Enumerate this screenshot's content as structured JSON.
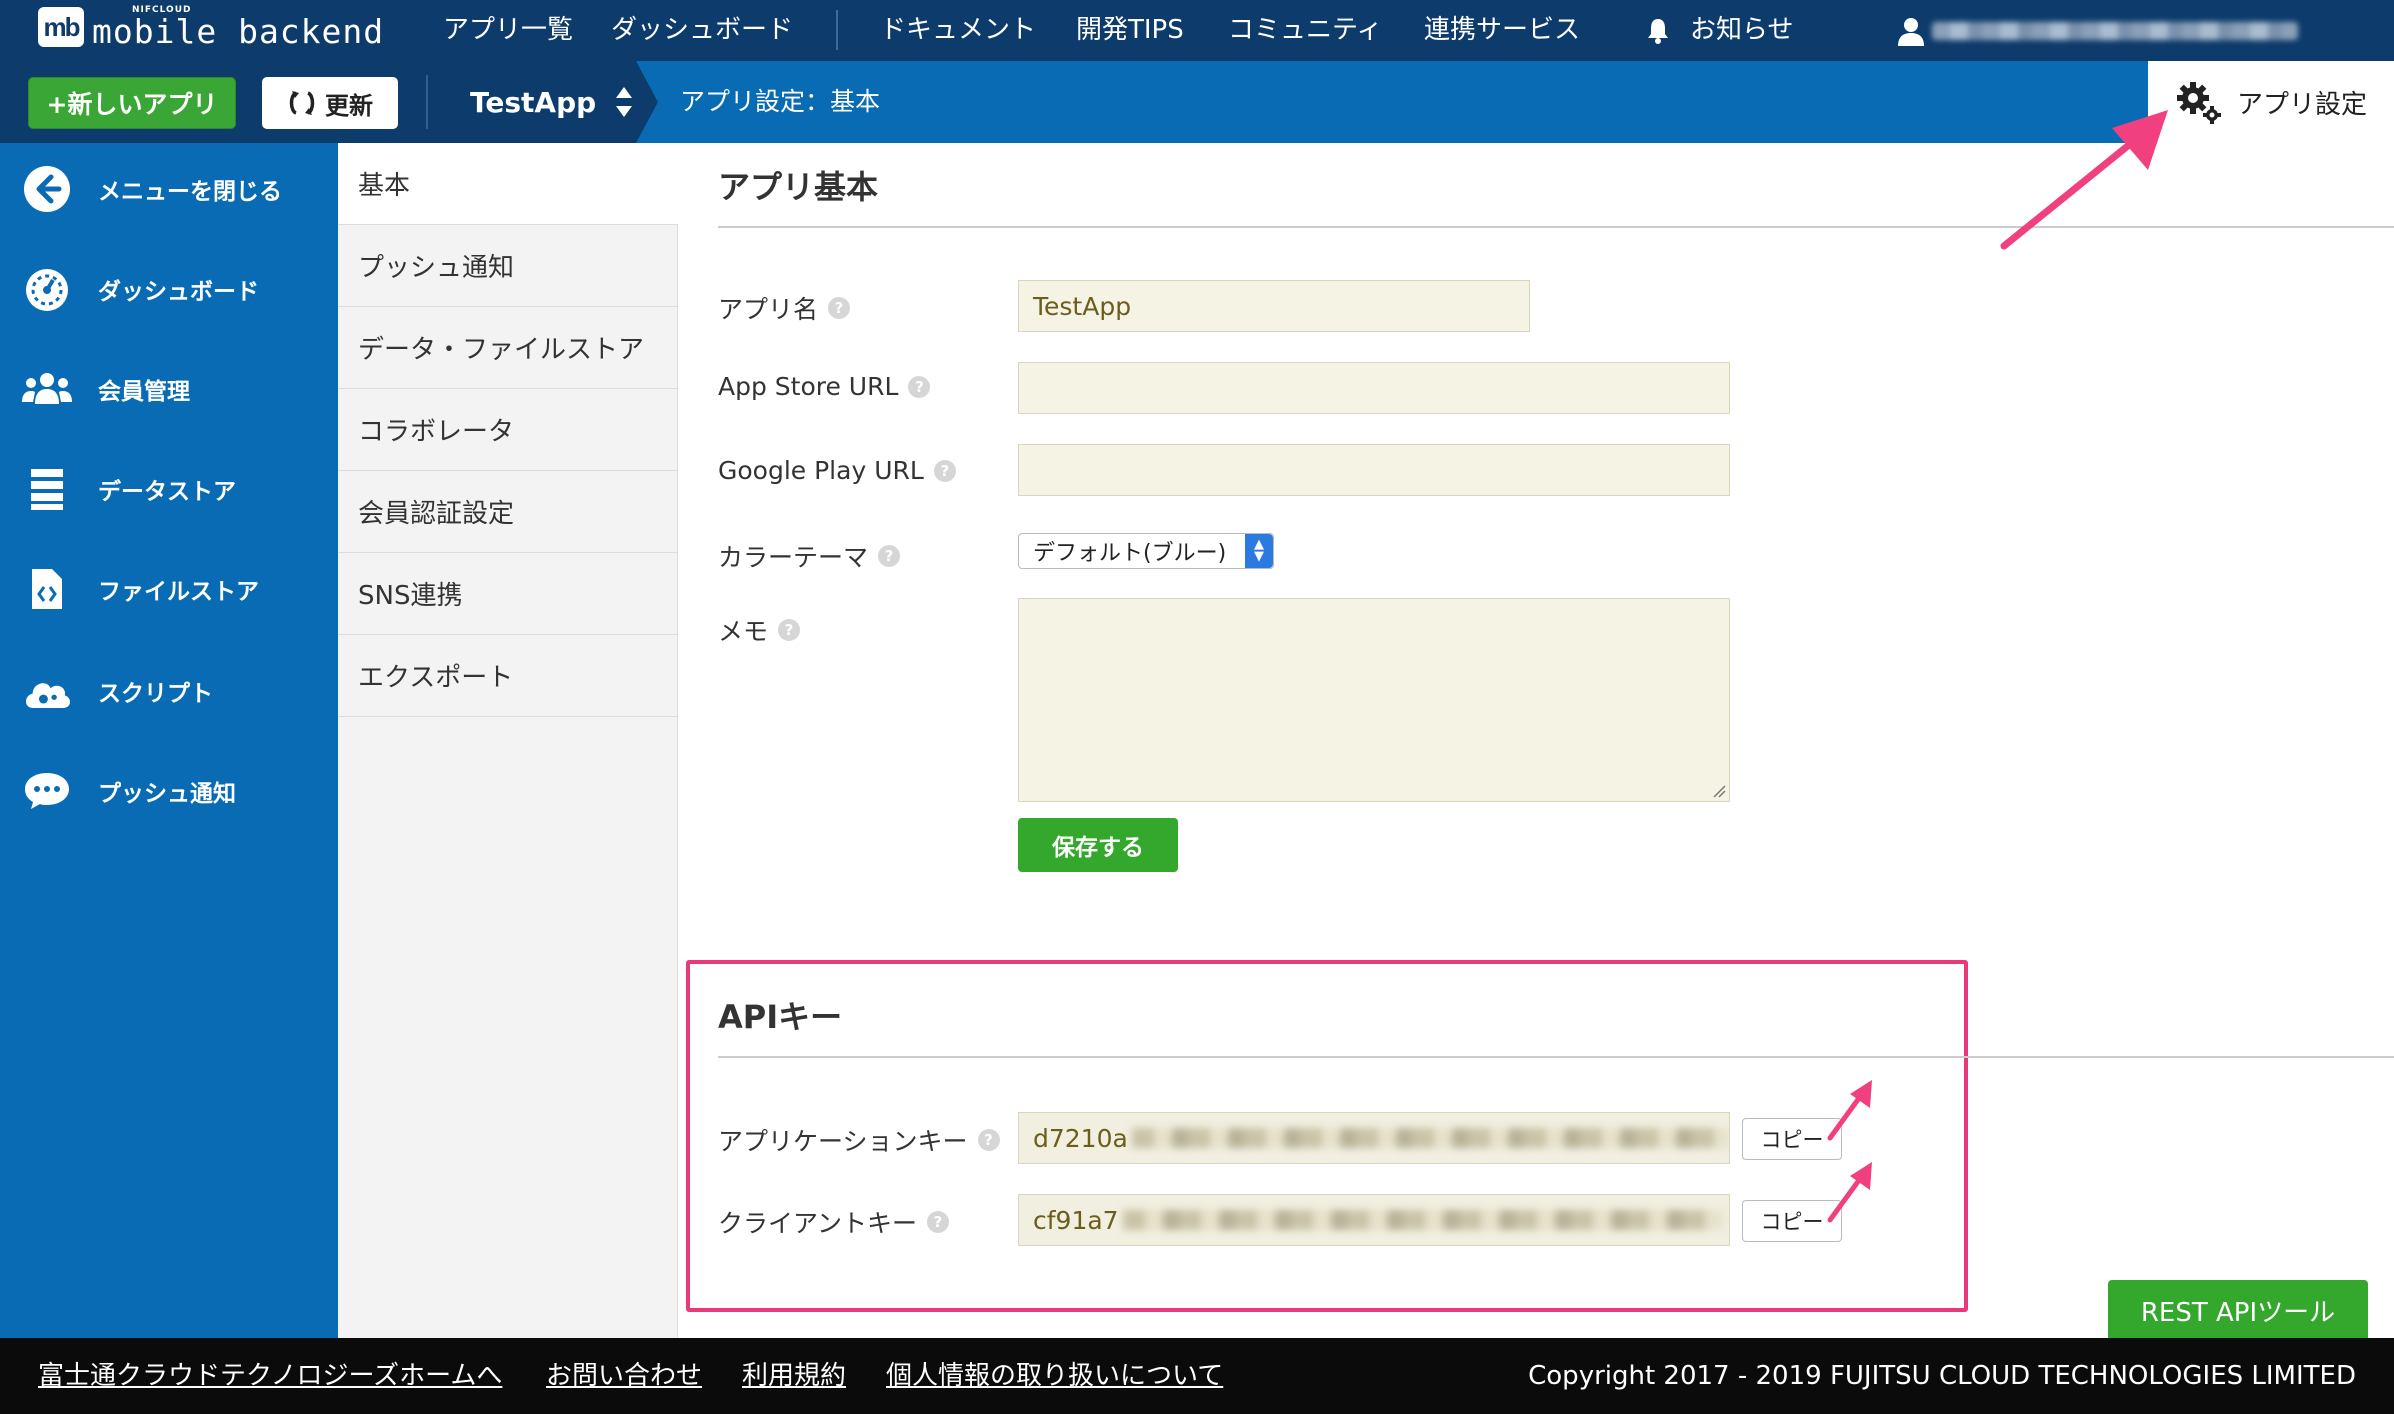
{
  "logo": {
    "mark": "mb",
    "small": "NIFCLOUD",
    "name": "mobile backend"
  },
  "top_nav": {
    "items": [
      "アプリ一覧",
      "ダッシュボード",
      "ドキュメント",
      "開発TIPS",
      "コミュニティ",
      "連携サービス"
    ],
    "notifications": "お知らせ"
  },
  "toolbar": {
    "new_app": "+新しいアプリ",
    "refresh": "更新",
    "app_name": "TestApp",
    "breadcrumb": "アプリ設定：基本",
    "app_settings": "アプリ設定"
  },
  "sidebar": {
    "items": [
      {
        "label": "メニューを閉じる",
        "icon": "arrow-left-icon"
      },
      {
        "label": "ダッシュボード",
        "icon": "gauge-icon"
      },
      {
        "label": "会員管理",
        "icon": "users-icon"
      },
      {
        "label": "データストア",
        "icon": "datastore-icon"
      },
      {
        "label": "ファイルストア",
        "icon": "file-icon"
      },
      {
        "label": "スクリプト",
        "icon": "cloud-gear-icon"
      },
      {
        "label": "プッシュ通知",
        "icon": "chat-bubble-icon"
      }
    ]
  },
  "submenu": {
    "items": [
      "基本",
      "プッシュ通知",
      "データ・ファイルストア",
      "コラボレータ",
      "会員認証設定",
      "SNS連携",
      "エクスポート"
    ],
    "active_index": 0
  },
  "basic": {
    "title": "アプリ基本",
    "app_name_label": "アプリ名",
    "app_name_value": "TestApp",
    "app_store_label": "App Store URL",
    "app_store_value": "",
    "google_play_label": "Google Play URL",
    "google_play_value": "",
    "color_theme_label": "カラーテーマ",
    "color_theme_value": "デフォルト(ブルー)",
    "memo_label": "メモ",
    "memo_value": "",
    "save": "保存する",
    "help": "?"
  },
  "api": {
    "title": "APIキー",
    "app_key_label": "アプリケーションキー",
    "app_key_value": "d7210a",
    "client_key_label": "クライアントキー",
    "client_key_value": "cf91a7",
    "copy": "コピー"
  },
  "rest_api": "REST APIツール",
  "footer": {
    "links": [
      "富士通クラウドテクノロジーズホームへ",
      "お問い合わせ",
      "利用規約",
      "個人情報の取り扱いについて"
    ],
    "copyright": "Copyright 2017 - 2019 FUJITSU CLOUD TECHNOLOGIES LIMITED"
  },
  "colors": {
    "nav_dark": "#0d3b6b",
    "nav_blue": "#0a6bb5",
    "green": "#34a82d",
    "highlight": "#e8397a"
  }
}
